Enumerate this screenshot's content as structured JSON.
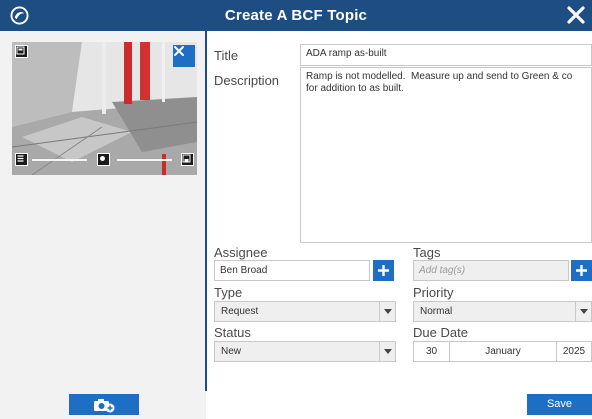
{
  "window": {
    "title": "Create A BCF Topic",
    "logo_icon": "app-logo-icon",
    "close_icon": "close-icon"
  },
  "snapshot": {
    "close_icon": "close-icon",
    "top_left_icon": "snapshot-icon",
    "bottom_icons": [
      "list-icon",
      "slider-handle-icon",
      "save-view-icon"
    ],
    "add_button_icon": "add-camera-icon"
  },
  "form": {
    "title_label": "Title",
    "title_value": "ADA ramp as-built",
    "description_label": "Description",
    "description_value": "Ramp is not modelled.  Measure up and send to Green & co for addition to as built.",
    "assignee_label": "Assignee",
    "assignee_value": "Ben Broad",
    "tags_label": "Tags",
    "tags_placeholder": "Add tag(s)",
    "type_label": "Type",
    "type_value": "Request",
    "priority_label": "Priority",
    "priority_value": "Normal",
    "status_label": "Status",
    "status_value": "New",
    "due_date_label": "Due Date",
    "due_day": "30",
    "due_month": "January",
    "due_year": "2025",
    "save_label": "Save"
  },
  "colors": {
    "titlebar": "#1e4d84",
    "accent": "#1e6fc3",
    "panel": "#f2f2f2"
  }
}
